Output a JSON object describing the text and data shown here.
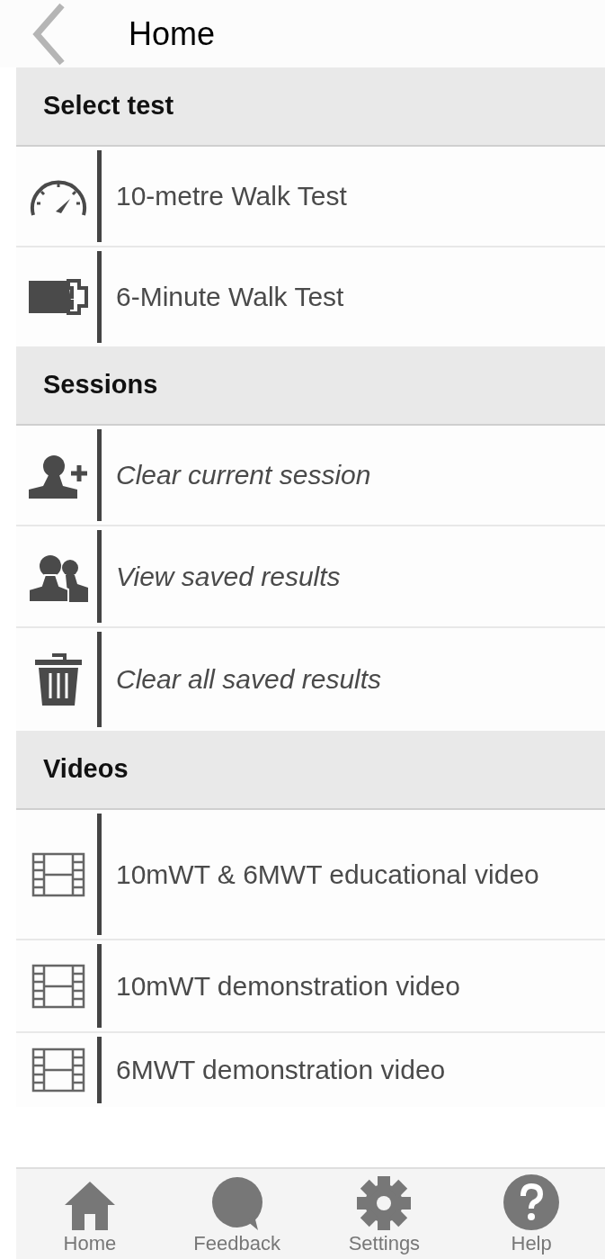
{
  "header": {
    "title": "Home"
  },
  "sections": [
    {
      "title": "Select test",
      "items": [
        {
          "label": "10-metre Walk Test",
          "italic": false
        },
        {
          "label": "6-Minute Walk Test",
          "italic": false
        }
      ]
    },
    {
      "title": "Sessions",
      "items": [
        {
          "label": "Clear current session",
          "italic": true
        },
        {
          "label": "View saved results",
          "italic": true
        },
        {
          "label": "Clear all saved results",
          "italic": true
        }
      ]
    },
    {
      "title": "Videos",
      "items": [
        {
          "label": "10mWT & 6MWT educational video",
          "italic": false
        },
        {
          "label": "10mWT demonstration video",
          "italic": false
        },
        {
          "label": "6MWT demonstration video",
          "italic": false
        }
      ]
    }
  ],
  "bottom_nav": [
    {
      "label": "Home"
    },
    {
      "label": "Feedback"
    },
    {
      "label": "Settings"
    },
    {
      "label": "Help"
    }
  ]
}
